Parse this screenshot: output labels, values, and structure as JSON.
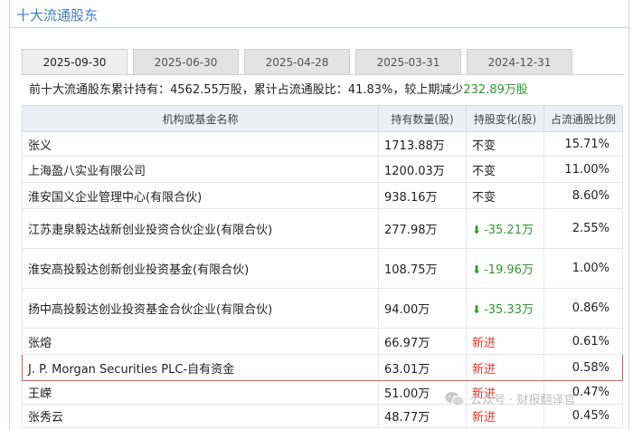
{
  "panel": {
    "title": "十大流通股东"
  },
  "tabs": [
    {
      "label": "2025-09-30",
      "active": true
    },
    {
      "label": "2025-06-30",
      "active": false
    },
    {
      "label": "2025-04-28",
      "active": false
    },
    {
      "label": "2025-03-31",
      "active": false
    },
    {
      "label": "2024-12-31",
      "active": false
    }
  ],
  "summary": {
    "prefix": "前十大流通股东累计持有：",
    "total": "4562.55万股",
    "ratio_label": "，累计占流通股比：",
    "ratio": "41.83%",
    "change_label": "，较上期减少",
    "change": "232.89万股"
  },
  "table": {
    "headers": [
      "机构或基金名称",
      "持有数量(股)",
      "持股变化(股)",
      "占流通股比例"
    ],
    "rows": [
      {
        "name": "张义",
        "qty": "1713.88万",
        "change": "不变",
        "change_type": "same",
        "pct": "15.71%"
      },
      {
        "name": "上海盈八实业有限公司",
        "qty": "1200.03万",
        "change": "不变",
        "change_type": "same",
        "pct": "11.00%"
      },
      {
        "name": "淮安国义企业管理中心(有限合伙)",
        "qty": "938.16万",
        "change": "不变",
        "change_type": "same",
        "pct": "8.60%"
      },
      {
        "name": "江苏疌泉毅达战新创业投资合伙企业(有限合伙)",
        "qty": "277.98万",
        "change": "-35.21万",
        "change_type": "decrease",
        "pct": "2.55%"
      },
      {
        "name": "淮安高投毅达创新创业投资基金(有限合伙)",
        "qty": "108.75万",
        "change": "-19.96万",
        "change_type": "decrease",
        "pct": "1.00%"
      },
      {
        "name": "扬中高投毅达创业投资基金合伙企业(有限合伙)",
        "qty": "94.00万",
        "change": "-35.33万",
        "change_type": "decrease",
        "pct": "0.86%"
      },
      {
        "name": "张熔",
        "qty": "66.97万",
        "change": "新进",
        "change_type": "new",
        "pct": "0.61%"
      },
      {
        "name": "J. P. Morgan Securities PLC-自有资金",
        "qty": "63.01万",
        "change": "新进",
        "change_type": "new",
        "pct": "0.58%",
        "highlight": true
      },
      {
        "name": "王嵘",
        "qty": "51.00万",
        "change": "新进",
        "change_type": "new",
        "pct": "0.47%"
      },
      {
        "name": "张秀云",
        "qty": "48.77万",
        "change": "新进",
        "change_type": "new",
        "pct": "0.45%"
      }
    ]
  },
  "watermark": {
    "text": "公众号 · 财报翻译官",
    "icon": "wechat-icon"
  },
  "colors": {
    "accent": "#3d7fc1",
    "decrease": "#2c9a2c",
    "new": "#e23a2c",
    "highlight_border": "#e05a4f"
  }
}
